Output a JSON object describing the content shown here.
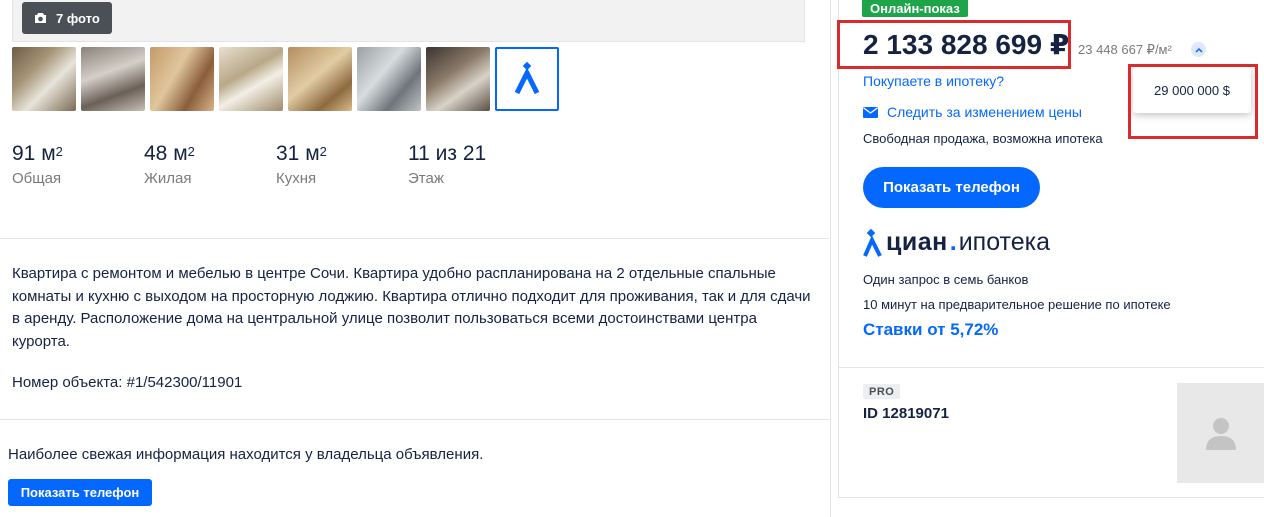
{
  "gallery": {
    "photo_count_label": "7 фото",
    "thumbnails": [
      "photo-1",
      "photo-2",
      "photo-3",
      "photo-4",
      "photo-5",
      "photo-6",
      "photo-7"
    ]
  },
  "stats": [
    {
      "value": "91 м",
      "sup": "2",
      "label": "Общая"
    },
    {
      "value": "48 м",
      "sup": "2",
      "label": "Жилая"
    },
    {
      "value": "31 м",
      "sup": "2",
      "label": "Кухня"
    },
    {
      "value": "11 из 21",
      "sup": "",
      "label": "Этаж"
    }
  ],
  "description": {
    "text": "Квартира с ремонтом и мебелью в центре Сочи. Квартира удобно распланирована на 2 отдельные спальные комнаты и кухню с выходом на просторную лоджию. Квартира отлично подходит для проживания, так и для сдачи в аренду. Расположение дома на центральной улице позволит пользоваться всеми достоинствами центра курорта.",
    "object_number": "Номер объекта: #1/542300/11901"
  },
  "footer_left": {
    "fresh_info": "Наиболее свежая информация находится у владельца объявления.",
    "phone_button": "Показать телефон"
  },
  "offer": {
    "badge": "Онлайн-показ",
    "price": "2 133 828 699 ₽",
    "price_per_m": "23 448 667 ₽/м²",
    "mortgage_question": "Покупаете в ипотеку?",
    "track_price": "Следить за изменением цены",
    "sale_type": "Свободная продажа, возможна ипотека",
    "usd_price": "29 000 000 $",
    "phone_button": "Показать телефон"
  },
  "cian_mortgage": {
    "logo_main": "циан",
    "logo_sub": "ипотека",
    "line1": "Один запрос в семь банков",
    "line2": "10 минут на предварительное решение по ипотеке",
    "rates": "Ставки от 5,72%"
  },
  "agent": {
    "badge": "PRO",
    "id": "ID 12819071"
  },
  "colors": {
    "accent": "#0468ff",
    "badge_green": "#1ea54a",
    "highlight_red": "#d92b2b"
  }
}
